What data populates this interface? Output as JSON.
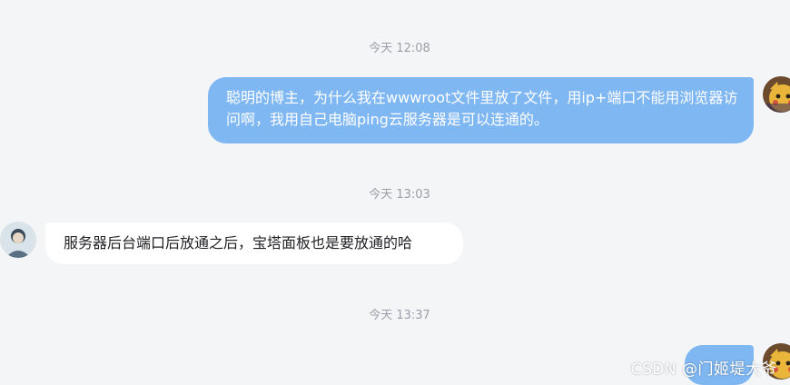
{
  "chat": {
    "messages": [
      {
        "timestamp": "今天 12:08",
        "sender": "blogger-reader",
        "side": "right",
        "text": "聪明的博主，为什么我在wwwroot文件里放了文件，用ip+端口不能用浏览器访问啊，我用自己电脑ping云服务器是可以连通的。"
      },
      {
        "timestamp": "今天 13:03",
        "sender": "blog-author",
        "side": "left",
        "text": "服务器后台端口后放通之后，宝塔面板也是要放通的哈"
      },
      {
        "timestamp": "今天 13:37",
        "sender": "blogger-reader",
        "side": "right",
        "text": ""
      }
    ]
  },
  "watermark": "CSDN @门姬堤大爷",
  "colors": {
    "background": "#f4f5f7",
    "outgoing_bubble": "#7fb7f2",
    "incoming_bubble": "#ffffff",
    "timestamp_text": "#9a9ea6"
  }
}
